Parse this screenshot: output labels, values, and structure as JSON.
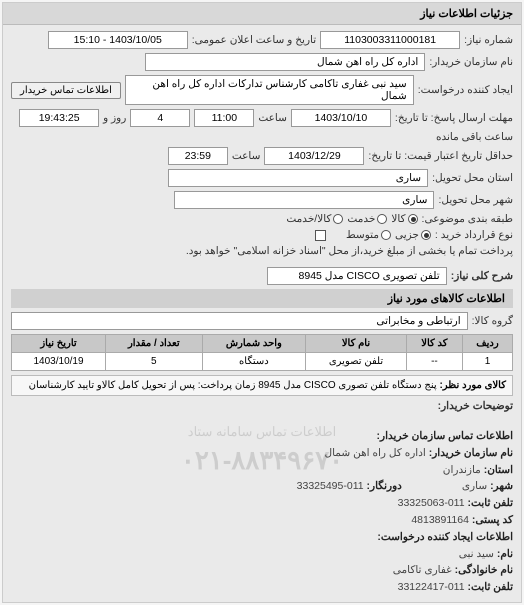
{
  "panel_title": "جزئیات اطلاعات نیاز",
  "fields": {
    "request_no_label": "شماره نیاز:",
    "request_no": "1103003311000181",
    "public_datetime_label": "تاریخ و ساعت اعلان عمومی:",
    "public_datetime": "1403/10/05 - 15:10",
    "buyer_org_label": "نام سازمان خریدار:",
    "buyer_org": "اداره کل راه اهن شمال",
    "requester_label": "ایجاد کننده درخواست:",
    "requester": "سید نبی غفاری تاکامی کارشناس تدارکات اداره کل راه اهن شمال",
    "buyer_contact_btn": "اطلاعات تماس خریدار",
    "deadline_label": "مهلت ارسال پاسخ: تا تاریخ:",
    "deadline_date": "1403/10/10",
    "deadline_time_label": "ساعت",
    "deadline_time": "11:00",
    "days_label": "روز و",
    "days_value": "4",
    "remaining_time_label": "ساعت باقی مانده",
    "remaining_time": "19:43:25",
    "validity_label": "حداقل تاریخ اعتبار قیمت: تا تاریخ:",
    "validity_date": "1403/12/29",
    "validity_time_label": "ساعت",
    "validity_time": "23:59",
    "province_label": "استان محل تحویل:",
    "city_label": "شهر محل تحویل:",
    "city": "ساری",
    "city2": "ساری",
    "category_label": "طبقه بندی موضوعی:",
    "opt_goods": "کالا",
    "opt_service": "خدمت",
    "opt_goods_service": "کالا/خدمت",
    "value_label": "نوع قرارداد خرید :",
    "opt_small": "جزیی",
    "opt_medium": "متوسط",
    "pay_note": "پرداخت تمام یا بخشی از مبلغ خرید،از محل \"اسناد خزانه اسلامی\" خواهد بود.",
    "desc_label": "شرح کلی نیاز:",
    "desc": "تلفن تصویری CISCO مدل 8945"
  },
  "items_section_title": "اطلاعات کالاهای مورد نیاز",
  "group_label": "گروه کالا:",
  "group_value": "ارتباطی و مخابراتی",
  "table": {
    "headers": [
      "ردیف",
      "کد کالا",
      "نام کالا",
      "واحد شمارش",
      "تعداد / مقدار",
      "تاریخ نیاز"
    ],
    "rows": [
      [
        "1",
        "--",
        "تلفن تصویری",
        "دستگاه",
        "5",
        "1403/10/19"
      ]
    ]
  },
  "item_note_label": "کالای مورد نظر:",
  "item_note": "پنج دستگاه تلفن تصوری CISCO مدل 8945 زمان پرداخت: پس از تحویل کامل کالاو تایید کارشناسان",
  "buyer_notes_label": "توضیحات خریدار:",
  "contact": {
    "section_title": "اطلاعات تماس سازمان خریدار:",
    "org_label": "نام سازمان خریدار:",
    "org": "اداره کل راه اهن شمال",
    "province_label": "استان:",
    "province": "مازندران",
    "city_label": "شهر:",
    "city": "ساری",
    "tel_label": "تلفن ثابت:",
    "tel": "011-33325063",
    "fax_label": "دورنگار:",
    "fax": "011-33325495",
    "post_label": "کد پستی:",
    "post": "4813891164",
    "requester_section": "اطلاعات ایجاد کننده درخواست:",
    "name_label": "نام:",
    "name": "سید نبی",
    "family_label": "نام خانوادگی:",
    "family": "غفاری تاکامی",
    "rtel_label": "تلفن ثابت:",
    "rtel": "011-33122417"
  },
  "watermark_main": "۰۲۱-۸۸۳۴۹۶۷۰",
  "watermark_sub": "اطلاعات تماس سامانه ستاد"
}
